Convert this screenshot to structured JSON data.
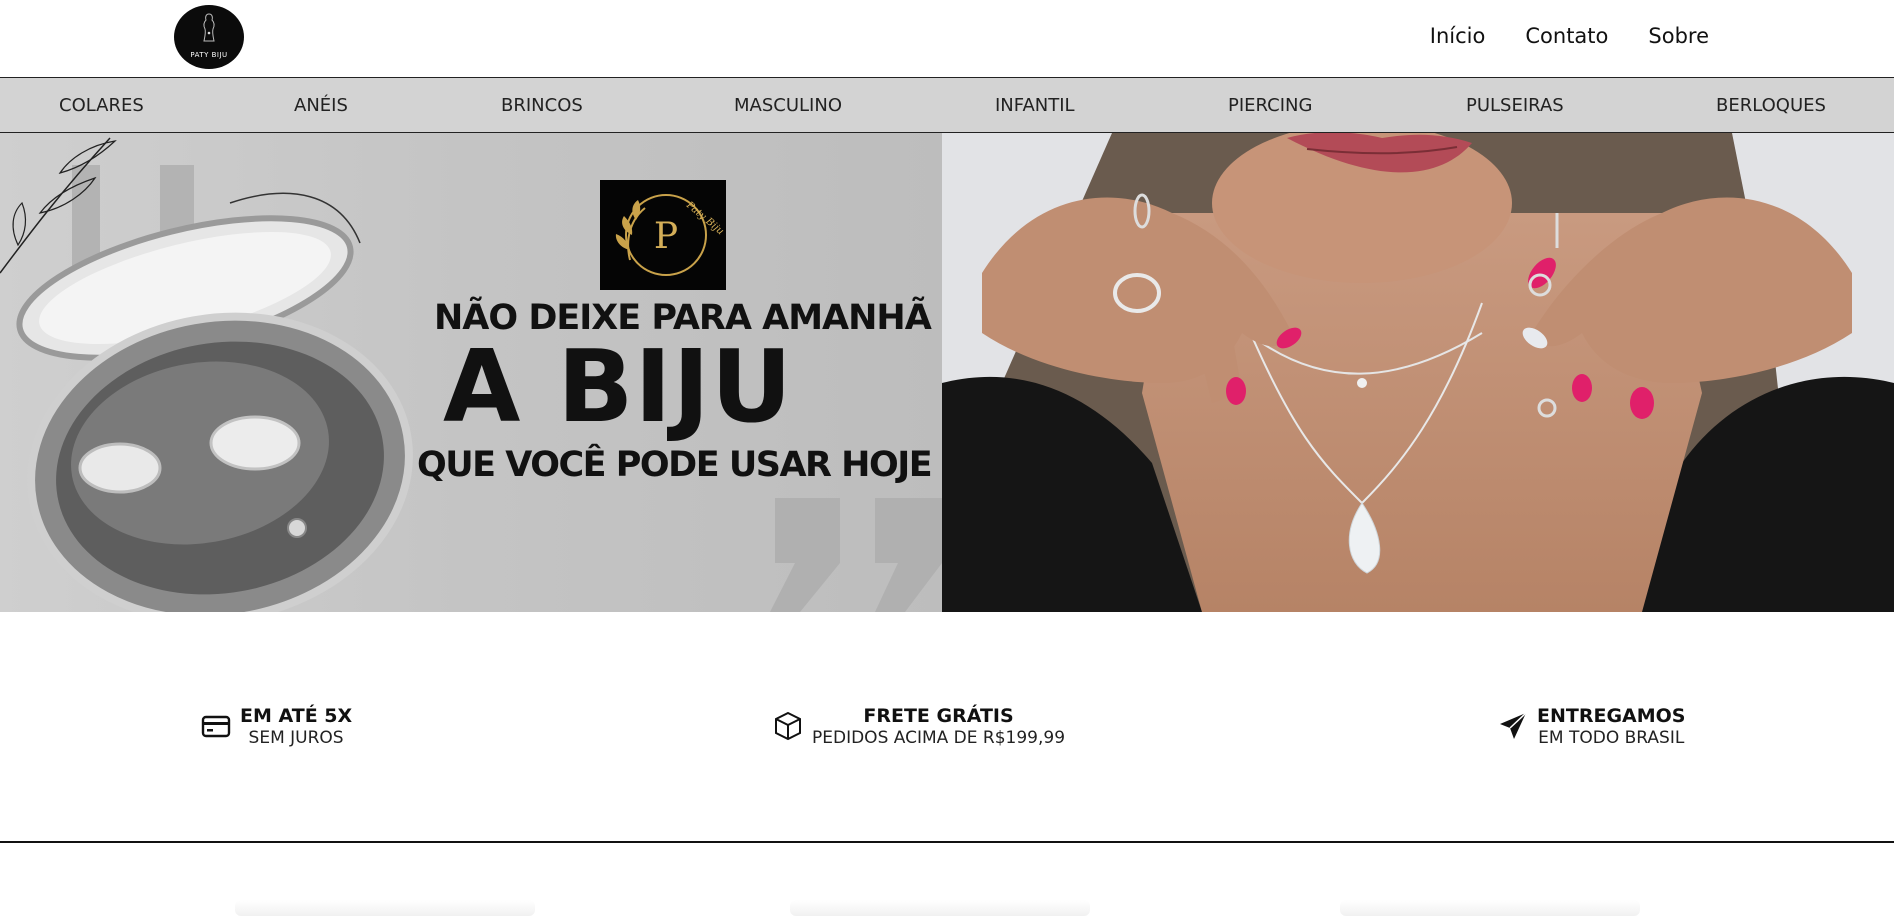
{
  "header": {
    "logo_text": "PATY BIJU",
    "nav": [
      {
        "label": "Início"
      },
      {
        "label": "Contato"
      },
      {
        "label": "Sobre"
      }
    ]
  },
  "categories": [
    {
      "label": "COLARES"
    },
    {
      "label": "ANÉIS"
    },
    {
      "label": "BRINCOS"
    },
    {
      "label": "MASCULINO"
    },
    {
      "label": "INFANTIL"
    },
    {
      "label": "PIERCING"
    },
    {
      "label": "PULSEIRAS"
    },
    {
      "label": "BERLOQUES"
    }
  ],
  "hero": {
    "brand_letter": "P",
    "brand_script": "Paty Biju",
    "line1": "NÃO DEIXE PARA AMANHÃ",
    "line2": "A BIJU",
    "line3": "QUE VOCÊ PODE USAR HOJE"
  },
  "benefits": [
    {
      "icon": "credit-card-icon",
      "title": "EM ATÉ 5X",
      "subtitle": "SEM JUROS"
    },
    {
      "icon": "box-icon",
      "title": "FRETE GRÁTIS",
      "subtitle": "PEDIDOS ACIMA DE R$199,99"
    },
    {
      "icon": "paper-plane-icon",
      "title": "ENTREGAMOS",
      "subtitle": "EM TODO BRASIL"
    }
  ],
  "colors": {
    "category_bar": "#d3d3d3",
    "text": "#111111",
    "brand_gold": "#c9a24a"
  }
}
